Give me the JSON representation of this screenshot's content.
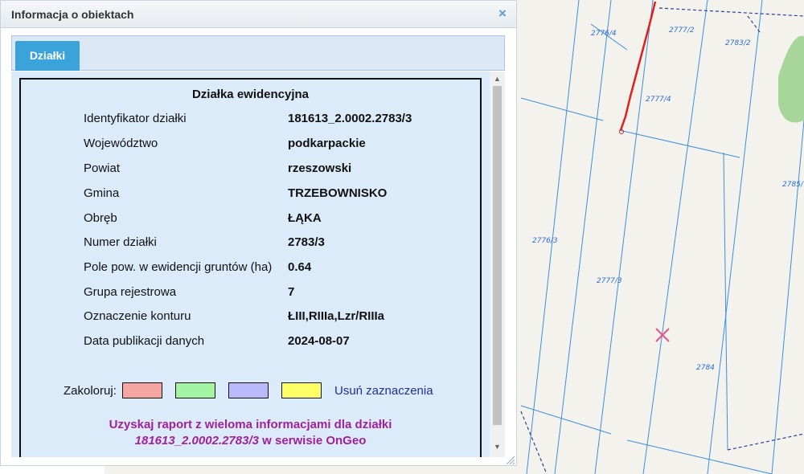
{
  "panel": {
    "title": "Informacja o obiektach",
    "close_icon": "×",
    "tabs": [
      {
        "label": "Działki",
        "active": true
      }
    ]
  },
  "parcel": {
    "heading": "Działka ewidencyjna",
    "rows": [
      {
        "label": "Identyfikator działki",
        "value": "181613_2.0002.2783/3"
      },
      {
        "label": "Województwo",
        "value": "podkarpackie"
      },
      {
        "label": "Powiat",
        "value": "rzeszowski"
      },
      {
        "label": "Gmina",
        "value": "TRZEBOWNISKO"
      },
      {
        "label": "Obręb",
        "value": "ŁĄKA"
      },
      {
        "label": "Numer działki",
        "value": "2783/3"
      },
      {
        "label": "Pole pow. w ewidencji gruntów (ha)",
        "value": "0.64"
      },
      {
        "label": "Grupa rejestrowa",
        "value": "7"
      },
      {
        "label": "Oznaczenie konturu",
        "value": "ŁIII,RIIIa,Lzr/RIIIa"
      },
      {
        "label": "Data publikacji danych",
        "value": "2024-08-07"
      }
    ]
  },
  "colorize": {
    "label": "Zakoloruj:",
    "swatches": [
      "#f5a6a3",
      "#a3f5a3",
      "#b9b9fb",
      "#ffff66"
    ],
    "clear_label": "Usuń zaznaczenia"
  },
  "report": {
    "line1": "Uzyskaj raport z wieloma informacjami dla działki",
    "parcel_id": "181613_2.0002.2783/3",
    "line2_suffix": " w serwisie OnGeo"
  },
  "map": {
    "labels": [
      "2776/4",
      "2777/2",
      "2783/2",
      "2777/4",
      "2785/",
      "2776/3",
      "2777/3",
      "2784"
    ],
    "marker_icon": "close-x-marker"
  },
  "colors": {
    "accent": "#3aa3d9",
    "report_text": "#a0219b",
    "link": "#1c2f9e",
    "map_line": "#3d8fe0",
    "highlight_line": "#e01e1e",
    "marker": "#e05a8a"
  }
}
